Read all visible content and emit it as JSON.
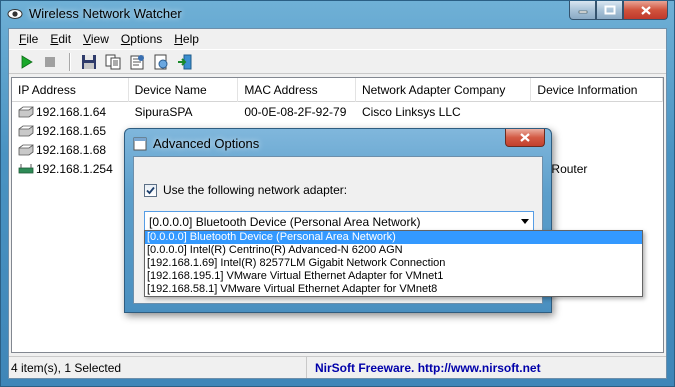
{
  "window": {
    "title": "Wireless Network Watcher"
  },
  "menu": [
    {
      "label": "File",
      "key": "F",
      "rest": "ile"
    },
    {
      "label": "Edit",
      "key": "E",
      "rest": "dit"
    },
    {
      "label": "View",
      "key": "V",
      "rest": "iew"
    },
    {
      "label": "Options",
      "key": "O",
      "rest": "ptions"
    },
    {
      "label": "Help",
      "key": "H",
      "rest": "elp"
    }
  ],
  "toolbar": {
    "icons": [
      "start-scan-icon",
      "stop-scan-icon",
      "save-icon",
      "copy-icon",
      "properties-icon",
      "html-report-icon",
      "exit-icon"
    ]
  },
  "columns": [
    "IP Address",
    "Device Name",
    "MAC Address",
    "Network Adapter Company",
    "Device Information"
  ],
  "rows": [
    {
      "ip": "192.168.1.64",
      "name": "SipuraSPA",
      "mac": "00-0E-08-2F-92-79",
      "company": "Cisco Linksys LLC",
      "info": ""
    },
    {
      "ip": "192.168.1.65",
      "name": "",
      "mac": "",
      "company": "",
      "info": ""
    },
    {
      "ip": "192.168.1.68",
      "name": "",
      "mac": "",
      "company": "",
      "info": ""
    },
    {
      "ip": "192.168.1.254",
      "name": "",
      "mac": "",
      "company": "",
      "info": "ur Router"
    }
  ],
  "status": {
    "count": "4 item(s), 1 Selected",
    "credit": "NirSoft Freeware.  http://www.nirsoft.net"
  },
  "dialog": {
    "title": "Advanced Options",
    "checkbox_label": "Use the following network adapter:",
    "checkbox_checked": true,
    "selected_adapter": "[0.0.0.0]  Bluetooth Device (Personal Area Network)",
    "adapters": [
      "[0.0.0.0]  Bluetooth Device (Personal Area Network)",
      "[0.0.0.0]  Intel(R) Centrino(R) Advanced-N 6200 AGN",
      "[192.168.1.69]  Intel(R) 82577LM Gigabit Network Connection",
      "[192.168.195.1]  VMware Virtual Ethernet Adapter for VMnet1",
      "[192.168.58.1]  VMware Virtual Ethernet Adapter for VMnet8"
    ]
  },
  "colors": {
    "titlebar": "#4a93c2",
    "selection": "#3399ff",
    "link": "#0000aa"
  }
}
